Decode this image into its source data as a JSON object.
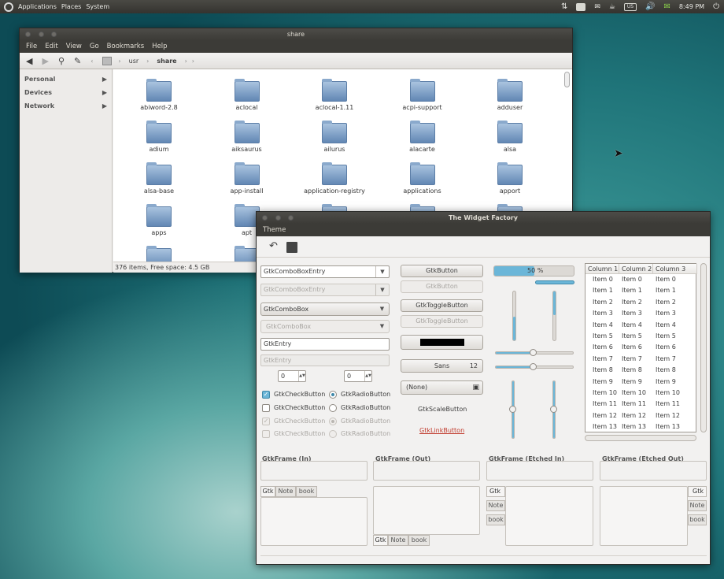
{
  "panel": {
    "menus": [
      "Applications",
      "Places",
      "System"
    ],
    "keyboard": "US",
    "time": "8:49 PM",
    "accent": "#3c3b37"
  },
  "nautilus": {
    "title": "share",
    "menu": [
      "File",
      "Edit",
      "View",
      "Go",
      "Bookmarks",
      "Help"
    ],
    "path": [
      "usr",
      "share"
    ],
    "sidebar": [
      "Personal",
      "Devices",
      "Network"
    ],
    "folders": [
      "abiword-2.8",
      "aclocal",
      "aclocal-1.11",
      "acpi-support",
      "adduser",
      "adium",
      "aiksaurus",
      "ailurus",
      "alacarte",
      "alsa",
      "alsa-base",
      "app-install",
      "application-registry",
      "applications",
      "apport",
      "apps",
      "apt"
    ],
    "status": "376 items, Free space: 4.5 GB"
  },
  "factory": {
    "title": "The Widget Factory",
    "menu": [
      "Theme"
    ],
    "combo_entry": "GtkComboBoxEntry",
    "combo_entry_dis": "GtkComboBoxEntry",
    "combo": "GtkComboBox",
    "combo_dis": "GtkComboBox",
    "entry": "GtkEntry",
    "entry_dis": "GtkEntry",
    "spin1": "0",
    "spin2": "0",
    "check": "GtkCheckButton",
    "radio": "GtkRadioButton",
    "button": "GtkButton",
    "toggle": "GtkToggleButton",
    "font": "Sans",
    "font_size": "12",
    "file": "(None)",
    "scale_btn": "GtkScaleButton",
    "link": "GtkLinkButton",
    "progress_label": "50 %",
    "progress": 0.5,
    "tree": {
      "columns": [
        "Column 1",
        "Column 2",
        "Column 3"
      ],
      "rows": [
        "Item 0",
        "Item 1",
        "Item 2",
        "Item 3",
        "Item 4",
        "Item 5",
        "Item 6",
        "Item 7",
        "Item 8",
        "Item 9",
        "Item 10",
        "Item 11",
        "Item 12",
        "Item 13"
      ]
    },
    "frames": [
      "GtkFrame (In)",
      "GtkFrame (Out)",
      "GtkFrame (Etched In)",
      "GtkFrame (Etched Out)"
    ],
    "tabs": [
      "Gtk",
      "Note",
      "book"
    ]
  }
}
